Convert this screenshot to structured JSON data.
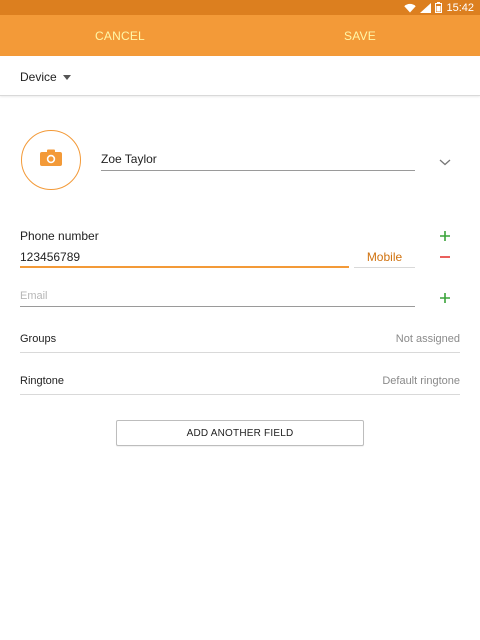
{
  "status_bar": {
    "time": "15:42",
    "icons": [
      "wifi-icon",
      "signal-icon",
      "battery-icon"
    ]
  },
  "action_bar": {
    "cancel_label": "CANCEL",
    "save_label": "SAVE"
  },
  "account": {
    "selected": "Device"
  },
  "contact": {
    "name": "Zoe Taylor",
    "photo_icon": "camera-icon"
  },
  "phone": {
    "label": "Phone number",
    "value": "123456789",
    "type": "Mobile"
  },
  "email": {
    "placeholder": "Email"
  },
  "groups": {
    "label": "Groups",
    "value": "Not assigned"
  },
  "ringtone": {
    "label": "Ringtone",
    "value": "Default ringtone"
  },
  "add_field_label": "ADD ANOTHER FIELD",
  "colors": {
    "accent": "#f39a38",
    "status_bar": "#dc7f1f",
    "action_text": "#fff7a8",
    "add_green": "#3aa33a",
    "remove_red": "#e53935"
  }
}
